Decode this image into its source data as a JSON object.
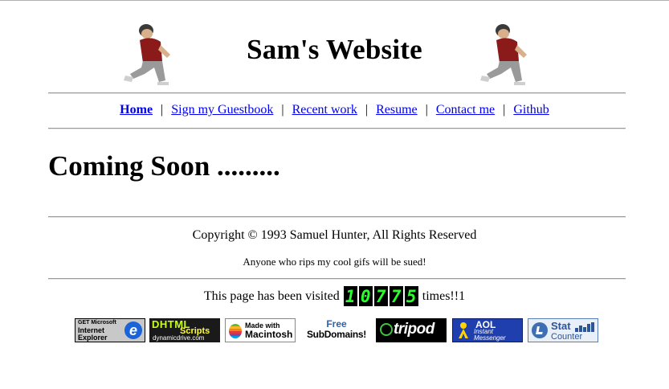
{
  "header": {
    "title": "Sam's Website"
  },
  "nav": {
    "items": [
      {
        "label": "Home",
        "active": true
      },
      {
        "label": "Sign my Guestbook"
      },
      {
        "label": "Recent work"
      },
      {
        "label": "Resume"
      },
      {
        "label": "Contact me"
      },
      {
        "label": "Github"
      }
    ],
    "separator": "|"
  },
  "main": {
    "heading": "Coming Soon ........."
  },
  "footer": {
    "copyright": "Copyright © 1993 Samuel Hunter, All Rights Reserved",
    "warning": "Anyone who rips my cool gifs will be sued!",
    "visits_prefix": "This page has been visited",
    "visit_digits": [
      "1",
      "0",
      "7",
      "7",
      "5"
    ],
    "visits_suffix": "times!!1"
  },
  "badges": {
    "ie": {
      "line1": "GET Microsoft",
      "line2": "Internet Explorer",
      "icon": "e"
    },
    "dhtml": {
      "line1": "DHTML",
      "line2": "Scripts",
      "line3": "dynamicdrive.com"
    },
    "mac": {
      "line1": "Made with",
      "line2": "Macintosh"
    },
    "subdomains": {
      "line1": "Free",
      "line2": "SubDomains!"
    },
    "tripod": {
      "label": "tripod"
    },
    "aol": {
      "line1": "AOL",
      "line2": "Instant Messenger"
    },
    "statcounter": {
      "line1": "Stat",
      "line2": "Counter"
    }
  },
  "colors": {
    "link": "#0000ee",
    "counter_digit": "#2bff2b"
  }
}
